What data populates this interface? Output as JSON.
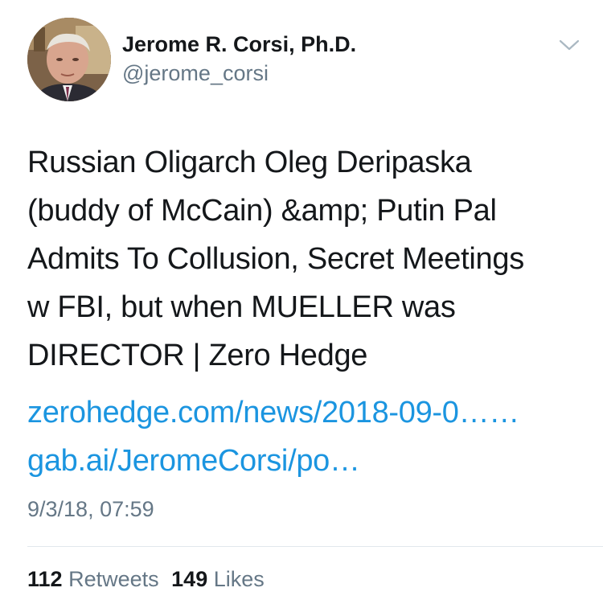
{
  "author": {
    "display_name": "Jerome R. Corsi, Ph.D.",
    "handle": "@jerome_corsi",
    "avatar_icon": "profile-photo"
  },
  "menu": {
    "icon": "chevron-down-icon"
  },
  "tweet": {
    "text_lines": [
      "Russian Oligarch Oleg Deripaska",
      "(buddy of McCain) &amp; Putin Pal",
      "Admits To Collusion, Secret Meetings",
      "w FBI, but when MUELLER was",
      "DIRECTOR | Zero Hedge"
    ],
    "links": [
      "zerohedge.com/news/2018-09-0……",
      "gab.ai/JeromeCorsi/po…"
    ],
    "timestamp": "9/3/18, 07:59"
  },
  "stats": {
    "retweets_count": "112",
    "retweets_label": "Retweets",
    "likes_count": "149",
    "likes_label": "Likes"
  },
  "colors": {
    "text_primary": "#14171a",
    "text_secondary": "#657786",
    "link": "#1b95e0",
    "divider": "#e1e8ed"
  }
}
